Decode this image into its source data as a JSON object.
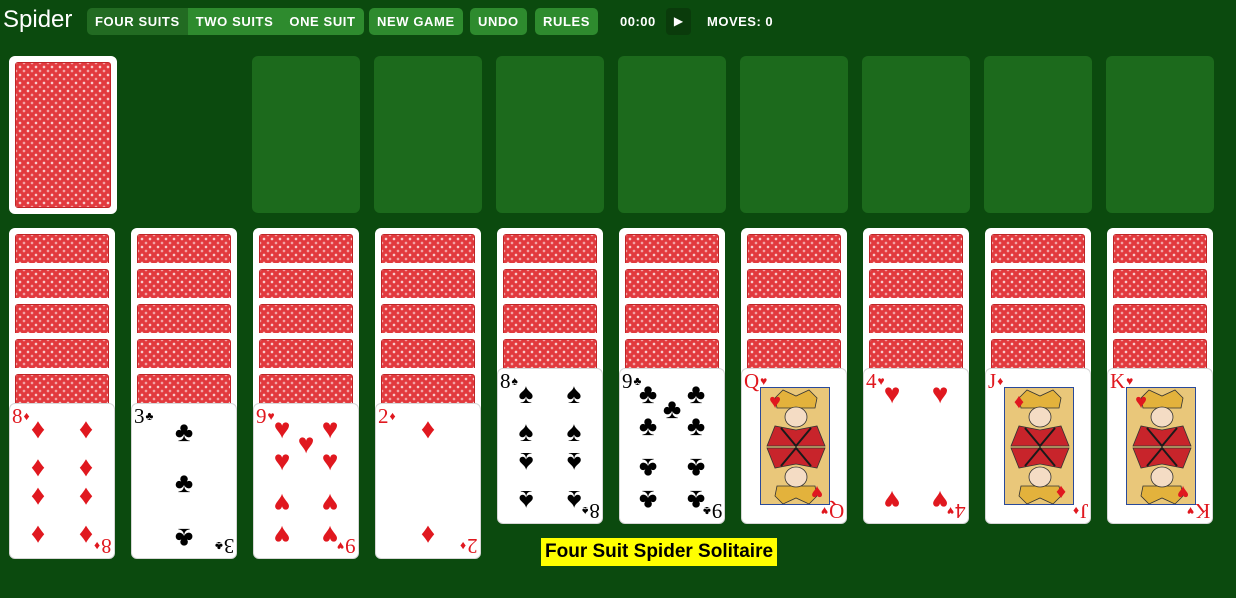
{
  "app": {
    "title": "Spider"
  },
  "toolbar": {
    "mode_buttons": [
      "FOUR SUITS",
      "TWO SUITS",
      "ONE SUIT"
    ],
    "active_mode": "FOUR SUITS",
    "new_game": "NEW GAME",
    "undo": "UNDO",
    "rules": "RULES",
    "timer": "00:00",
    "play_icon": "play-icon",
    "moves": "MOVES: 0"
  },
  "colors": {
    "felt": "#0b4a0e",
    "slot": "#1c6a1c",
    "button": "#2e8b2e",
    "card_back": "#e23a3e",
    "banner": "#ffff00"
  },
  "stock": {
    "face_down": true
  },
  "foundations": {
    "count": 8,
    "filled": 0
  },
  "tableau": [
    {
      "face_down": 5,
      "top": {
        "rank": "8",
        "suit": "♦"
      }
    },
    {
      "face_down": 5,
      "top": {
        "rank": "3",
        "suit": "♣"
      }
    },
    {
      "face_down": 5,
      "top": {
        "rank": "9",
        "suit": "♥"
      }
    },
    {
      "face_down": 5,
      "top": {
        "rank": "2",
        "suit": "♦"
      }
    },
    {
      "face_down": 4,
      "top": {
        "rank": "8",
        "suit": "♠"
      }
    },
    {
      "face_down": 4,
      "top": {
        "rank": "9",
        "suit": "♣"
      }
    },
    {
      "face_down": 4,
      "top": {
        "rank": "Q",
        "suit": "♥"
      }
    },
    {
      "face_down": 4,
      "top": {
        "rank": "4",
        "suit": "♥"
      }
    },
    {
      "face_down": 4,
      "top": {
        "rank": "J",
        "suit": "♦"
      }
    },
    {
      "face_down": 4,
      "top": {
        "rank": "K",
        "suit": "♥"
      }
    }
  ],
  "banner": {
    "text": "Four Suit Spider Solitaire"
  }
}
